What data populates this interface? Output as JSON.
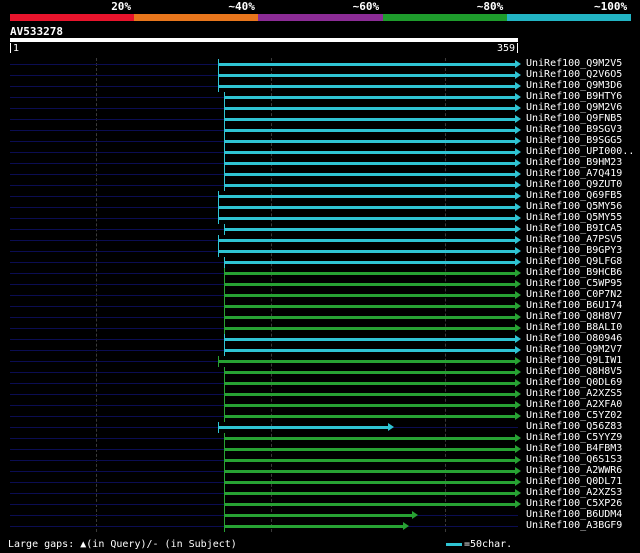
{
  "scale": {
    "labels": [
      "20%",
      "~40%",
      "~60%",
      "~80%",
      "~100%"
    ],
    "colors": [
      "#e8142c",
      "#e8761c",
      "#8c2c96",
      "#1e9c2c",
      "#22b4c4"
    ]
  },
  "query": {
    "id": "AV533278",
    "start": "1",
    "end": "359",
    "length": 359
  },
  "colors": {
    "cyan": "#2fc4d4",
    "green": "#27a233",
    "row_bg": "#0b0d52"
  },
  "rows": [
    {
      "label": "UniRef100_Q9M2V5",
      "start": 148,
      "end": 359,
      "color": "cyan"
    },
    {
      "label": "UniRef100_Q2V6O5",
      "start": 148,
      "end": 359,
      "color": "cyan"
    },
    {
      "label": "UniRef100_Q9M3D6",
      "start": 148,
      "end": 359,
      "color": "cyan"
    },
    {
      "label": "UniRef100_B9HTY6",
      "start": 152,
      "end": 359,
      "color": "cyan"
    },
    {
      "label": "UniRef100_Q9M2V6",
      "start": 152,
      "end": 359,
      "color": "cyan"
    },
    {
      "label": "UniRef100_Q9FNB5",
      "start": 152,
      "end": 359,
      "color": "cyan"
    },
    {
      "label": "UniRef100_B9SGV3",
      "start": 152,
      "end": 359,
      "color": "cyan"
    },
    {
      "label": "UniRef100_B9SGG5",
      "start": 152,
      "end": 359,
      "color": "cyan"
    },
    {
      "label": "UniRef100_UPI000..",
      "start": 152,
      "end": 359,
      "color": "cyan"
    },
    {
      "label": "UniRef100_B9HM23",
      "start": 152,
      "end": 359,
      "color": "cyan"
    },
    {
      "label": "UniRef100_A7Q419",
      "start": 152,
      "end": 359,
      "color": "cyan"
    },
    {
      "label": "UniRef100_Q9ZUT0",
      "start": 152,
      "end": 359,
      "color": "cyan"
    },
    {
      "label": "UniRef100_Q69FB5",
      "start": 148,
      "end": 359,
      "color": "cyan"
    },
    {
      "label": "UniRef100_Q5MY56",
      "start": 148,
      "end": 359,
      "color": "cyan"
    },
    {
      "label": "UniRef100_Q5MY55",
      "start": 148,
      "end": 359,
      "color": "cyan"
    },
    {
      "label": "UniRef100_B9ICA5",
      "start": 152,
      "end": 359,
      "color": "cyan"
    },
    {
      "label": "UniRef100_A7PSV5",
      "start": 148,
      "end": 359,
      "color": "cyan"
    },
    {
      "label": "UniRef100_B9GPY3",
      "start": 148,
      "end": 359,
      "color": "cyan"
    },
    {
      "label": "UniRef100_Q9LFG8",
      "start": 152,
      "end": 359,
      "color": "cyan"
    },
    {
      "label": "UniRef100_B9HCB6",
      "start": 152,
      "end": 359,
      "color": "green"
    },
    {
      "label": "UniRef100_C5WP95",
      "start": 152,
      "end": 359,
      "color": "green"
    },
    {
      "label": "UniRef100_C0P7N2",
      "start": 152,
      "end": 359,
      "color": "green"
    },
    {
      "label": "UniRef100_B6U174",
      "start": 152,
      "end": 359,
      "color": "green"
    },
    {
      "label": "UniRef100_Q8H8V7",
      "start": 152,
      "end": 359,
      "color": "green"
    },
    {
      "label": "UniRef100_B8ALI0",
      "start": 152,
      "end": 359,
      "color": "green"
    },
    {
      "label": "UniRef100_O80946",
      "start": 152,
      "end": 359,
      "color": "cyan"
    },
    {
      "label": "UniRef100_Q9M2V7",
      "start": 152,
      "end": 359,
      "color": "cyan"
    },
    {
      "label": "UniRef100_Q9LIW1",
      "start": 148,
      "end": 359,
      "color": "green"
    },
    {
      "label": "UniRef100_Q8H8V5",
      "start": 152,
      "end": 359,
      "color": "green"
    },
    {
      "label": "UniRef100_Q0DL69",
      "start": 152,
      "end": 359,
      "color": "green"
    },
    {
      "label": "UniRef100_A2XZS5",
      "start": 152,
      "end": 359,
      "color": "green"
    },
    {
      "label": "UniRef100_A2XFA0",
      "start": 152,
      "end": 359,
      "color": "green"
    },
    {
      "label": "UniRef100_C5YZ02",
      "start": 152,
      "end": 359,
      "color": "green"
    },
    {
      "label": "UniRef100_Q56Z83",
      "start": 148,
      "end": 269,
      "color": "cyan"
    },
    {
      "label": "UniRef100_C5YYZ9",
      "start": 152,
      "end": 359,
      "color": "green"
    },
    {
      "label": "UniRef100_B4FBM3",
      "start": 152,
      "end": 359,
      "color": "green"
    },
    {
      "label": "UniRef100_Q6S1S3",
      "start": 152,
      "end": 359,
      "color": "green"
    },
    {
      "label": "UniRef100_A2WWR6",
      "start": 152,
      "end": 359,
      "color": "green"
    },
    {
      "label": "UniRef100_Q0DL71",
      "start": 152,
      "end": 359,
      "color": "green"
    },
    {
      "label": "UniRef100_A2XZS3",
      "start": 152,
      "end": 359,
      "color": "green"
    },
    {
      "label": "UniRef100_C5XP26",
      "start": 152,
      "end": 359,
      "color": "green"
    },
    {
      "label": "UniRef100_B6UDM4",
      "start": 152,
      "end": 286,
      "color": "green"
    },
    {
      "label": "UniRef100_A3BGF9",
      "start": 152,
      "end": 280,
      "color": "green"
    }
  ],
  "footer": {
    "gaps_text": "Large gaps: ",
    "gaps_query_icon": "▲",
    "gaps_rest": "(in Query)/- (in Subject)",
    "legend_text": "=50char."
  }
}
